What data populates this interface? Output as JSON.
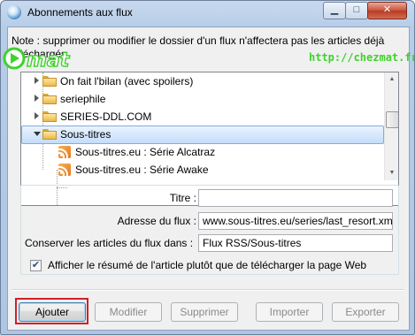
{
  "window": {
    "title": "Abonnements aux flux",
    "minimize_glyph": "▁",
    "maximize_glyph": "□",
    "close_glyph": "✕"
  },
  "note": "Note : supprimer ou modifier le dossier d'un flux n'affectera pas les articles déjà téléchargés.",
  "watermark": {
    "logo_text": "mat",
    "url": "http://chezmat.fr"
  },
  "tree": {
    "items": [
      {
        "label": "On fait l'bilan (avec spoilers)",
        "type": "folder",
        "expanded": false
      },
      {
        "label": "seriephile",
        "type": "folder",
        "expanded": false
      },
      {
        "label": "SERIES-DDL.COM",
        "type": "folder",
        "expanded": false
      },
      {
        "label": "Sous-titres",
        "type": "folder",
        "expanded": true,
        "selected": true
      },
      {
        "label": "Sous-titres.eu : Série Alcatraz",
        "type": "feed"
      },
      {
        "label": "Sous-titres.eu : Série Awake",
        "type": "feed"
      }
    ],
    "scroll_up": "▲",
    "scroll_down": "▼"
  },
  "form": {
    "title_label": "Titre :",
    "title_value": "",
    "url_label": "Adresse du flux :",
    "url_value": "www.sous-titres.eu/series/last_resort.xml",
    "folder_label": "Conserver les articles du flux dans :",
    "folder_value": "Flux RSS/Sous-titres",
    "summary_label": "Afficher le résumé de l'article plutôt que de télécharger la page Web",
    "summary_checked": true,
    "check_glyph": "✔"
  },
  "buttons": {
    "add": "Ajouter",
    "edit": "Modifier",
    "delete": "Supprimer",
    "import": "Importer",
    "export": "Exporter"
  },
  "colors": {
    "highlight_border": "#d11f2a",
    "watermark_green": "#3fd12e",
    "selection_bg": "#c4ddfc"
  }
}
